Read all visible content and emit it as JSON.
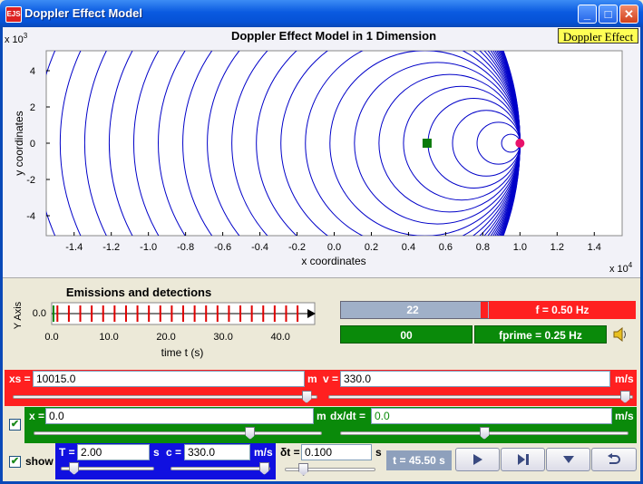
{
  "window": {
    "title": "Doppler Effect Model",
    "icon_text": "EJS",
    "buttons": {
      "minimize": "_",
      "maximize": "□",
      "close": "✕"
    }
  },
  "main_plot": {
    "title": "Doppler Effect Model in 1 Dimension",
    "tag": "Doppler Effect",
    "x_label": "x coordinates",
    "y_label": "y coordinates",
    "x_exponent": "x 10",
    "x_exponent_power": "4",
    "y_exponent": "x 10",
    "y_exponent_power": "3",
    "x_ticks": [
      "-1.4",
      "-1.2",
      "-1.0",
      "-0.8",
      "-0.6",
      "-0.4",
      "-0.2",
      "0.0",
      "0.2",
      "0.4",
      "0.6",
      "0.8",
      "1.0",
      "1.2",
      "1.4"
    ],
    "y_ticks": [
      "4",
      "2",
      "0",
      "-2",
      "-4"
    ],
    "x_tick_values": [
      -1.4,
      -1.2,
      -1.0,
      -0.8,
      -0.6,
      -0.4,
      -0.2,
      0.0,
      0.2,
      0.4,
      0.6,
      0.8,
      1.0,
      1.2,
      1.4
    ],
    "y_tick_values": [
      4,
      2,
      0,
      -2,
      -4
    ],
    "xlim": [
      -1.55,
      1.55
    ],
    "ylim": [
      -5.1,
      5.1
    ],
    "source_x": 1.0,
    "observer_x": 0.5,
    "wave_speed": 330.0,
    "source_speed": 330.0,
    "period": 2.0,
    "time": 45.5,
    "line_color": "#0000c8",
    "source_color": "#e8126a",
    "observer_color": "#0a7a0a"
  },
  "emission_plot": {
    "title": "Emissions and detections",
    "y_label": "Y Axis",
    "x_label": "time t (s)",
    "y_tick": "0.0",
    "x_ticks": [
      "0.0",
      "10.0",
      "20.0",
      "30.0",
      "40.0"
    ],
    "x_tick_values": [
      0,
      10,
      20,
      30,
      40
    ],
    "xlim": [
      0,
      46
    ],
    "emission_count": 22,
    "emission_period": 2.0
  },
  "counters": {
    "emissions": "22",
    "frequency": "f = 0.50 Hz",
    "detections": "00",
    "fprime": "fprime = 0.25 Hz",
    "speaker_icon": "speaker-icon",
    "emission_fill_fraction": 0.94
  },
  "controls": {
    "xs_label": "xs =",
    "xs_value": "10015.0",
    "xs_unit": "m",
    "v_label": "v =",
    "v_value": "330.0",
    "v_unit": "m/s",
    "x_label": "x =",
    "x_value": "0.0",
    "x_unit": "m",
    "dxdt_label": "dx/dt =",
    "dxdt_value": "0.0",
    "dxdt_unit": "m/s",
    "T_label": "T =",
    "T_value": "2.00",
    "T_unit": "s",
    "c_label": "c =",
    "c_value": "330.0",
    "c_unit": "m/s",
    "dt_label": "δt =",
    "dt_value": "0.100",
    "dt_unit": "s",
    "show_label": "show",
    "time_display": "t = 45.50 s",
    "xs_slider_fraction": 0.98,
    "v_slider_fraction": 0.99,
    "x_slider_fraction": 0.76,
    "dxdt_slider_fraction": 0.5,
    "T_slider_fraction": 0.1,
    "c_slider_fraction": 0.99,
    "dt_slider_fraction": 0.17
  }
}
